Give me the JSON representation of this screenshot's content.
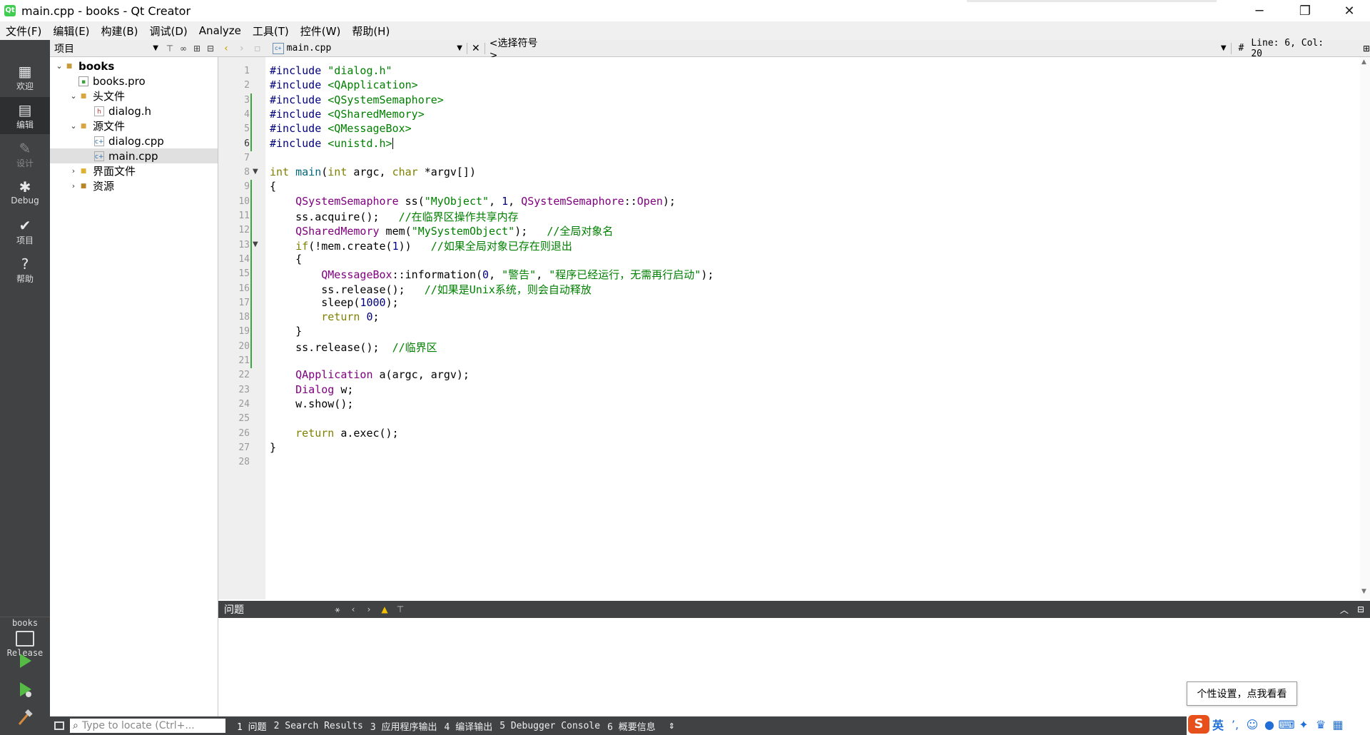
{
  "window": {
    "title": "main.cpp - books - Qt Creator",
    "app_icon": "Qt"
  },
  "menus": [
    "文件(F)",
    "编辑(E)",
    "构建(B)",
    "调试(D)",
    "Analyze",
    "工具(T)",
    "控件(W)",
    "帮助(H)"
  ],
  "modes": [
    {
      "label": "欢迎",
      "icon": "grid-icon"
    },
    {
      "label": "编辑",
      "icon": "document-icon",
      "active": true
    },
    {
      "label": "设计",
      "icon": "pencil-icon",
      "disabled": true
    },
    {
      "label": "Debug",
      "icon": "bug-icon"
    },
    {
      "label": "项目",
      "icon": "wrench-icon"
    },
    {
      "label": "帮助",
      "icon": "help-icon"
    }
  ],
  "kit": {
    "project": "books",
    "config": "Release"
  },
  "project_panel": {
    "title": "项目",
    "tree": [
      {
        "label": "books",
        "bold": true,
        "arrow": "v",
        "indent": 0,
        "icon": "project-folder-icon"
      },
      {
        "label": "books.pro",
        "indent": 1,
        "icon": "pro-file-icon"
      },
      {
        "label": "头文件",
        "arrow": "v",
        "indent": 1,
        "icon": "header-folder-icon"
      },
      {
        "label": "dialog.h",
        "indent": 2,
        "icon": "h-file-icon"
      },
      {
        "label": "源文件",
        "arrow": "v",
        "indent": 1,
        "icon": "source-folder-icon"
      },
      {
        "label": "dialog.cpp",
        "indent": 2,
        "icon": "cpp-file-icon"
      },
      {
        "label": "main.cpp",
        "indent": 2,
        "icon": "cpp-file-icon",
        "selected": true
      },
      {
        "label": "界面文件",
        "arrow": ">",
        "indent": 1,
        "icon": "form-folder-icon"
      },
      {
        "label": "资源",
        "arrow": ">",
        "indent": 1,
        "icon": "resource-folder-icon"
      }
    ]
  },
  "editor_toolbar": {
    "file": "main.cpp",
    "symbol": "<选择符号>",
    "hash": "#",
    "position": "Line: 6, Col: 20"
  },
  "code_lines": [
    "<span class=\"pp\">#include</span> <span class=\"str\">\"dialog.h\"</span>",
    "<span class=\"pp\">#include</span> <span class=\"str\">&lt;QApplication&gt;</span>",
    "<span class=\"pp\">#include</span> <span class=\"str\">&lt;QSystemSemaphore&gt;</span>",
    "<span class=\"pp\">#include</span> <span class=\"str\">&lt;QSharedMemory&gt;</span>",
    "<span class=\"pp\">#include</span> <span class=\"str\">&lt;QMessageBox&gt;</span>",
    "<span class=\"pp\">#include</span> <span class=\"str\">&lt;unistd.h&gt;</span><span class=\"caret\"></span>",
    "",
    "<span class=\"kw\">int</span> <span class=\"fn\">main</span>(<span class=\"kw\">int</span> argc, <span class=\"kw\">char</span> *argv[])",
    "{",
    "    <span class=\"cls\">QSystemSemaphore</span> ss(<span class=\"str\">\"MyObject\"</span>, <span class=\"num\">1</span>, <span class=\"cls\">QSystemSemaphore</span>::<span class=\"cls\">Open</span>);",
    "    ss.acquire();   <span class=\"cmt\">//在临界区操作共享内存</span>",
    "    <span class=\"cls\">QSharedMemory</span> mem(<span class=\"str\">\"MySystemObject\"</span>);   <span class=\"cmt\">//全局对象名</span>",
    "    <span class=\"kw\">if</span>(!mem.create(<span class=\"num\">1</span>))   <span class=\"cmt\">//如果全局对象已存在则退出</span>",
    "    {",
    "        <span class=\"cls\">QMessageBox</span>::information(<span class=\"num\">0</span>, <span class=\"str\">\"警告\"</span>, <span class=\"str\">\"程序已经运行，无需再行启动\"</span>);",
    "        ss.release();   <span class=\"cmt\">//如果是Unix系统，则会自动释放</span>",
    "        sleep(<span class=\"num\">1000</span>);",
    "        <span class=\"kw\">return</span> <span class=\"num\">0</span>;",
    "    }",
    "    ss.release();  <span class=\"cmt\">//临界区</span>",
    "",
    "    <span class=\"cls\">QApplication</span> a(argc, argv);",
    "    <span class=\"cls\">Dialog</span> w;",
    "    w.show();",
    "",
    "    <span class=\"kw\">return</span> a.exec();",
    "}",
    ""
  ],
  "output_pane": {
    "title": "问题"
  },
  "status_bar": {
    "locator_placeholder": "Type to locate (Ctrl+...",
    "tabs": [
      "1 问题",
      "2 Search Results",
      "3 应用程序输出",
      "4 编译输出",
      "5 Debugger Console",
      "6 概要信息"
    ]
  },
  "ime": {
    "logo": "S",
    "lang": "英",
    "tooltip": "个性设置，点我看看"
  },
  "colors": {
    "modebar": "#404244",
    "change_marker": "#3ca83c",
    "keyword": "#808000",
    "string": "#008000",
    "type": "#800080"
  }
}
